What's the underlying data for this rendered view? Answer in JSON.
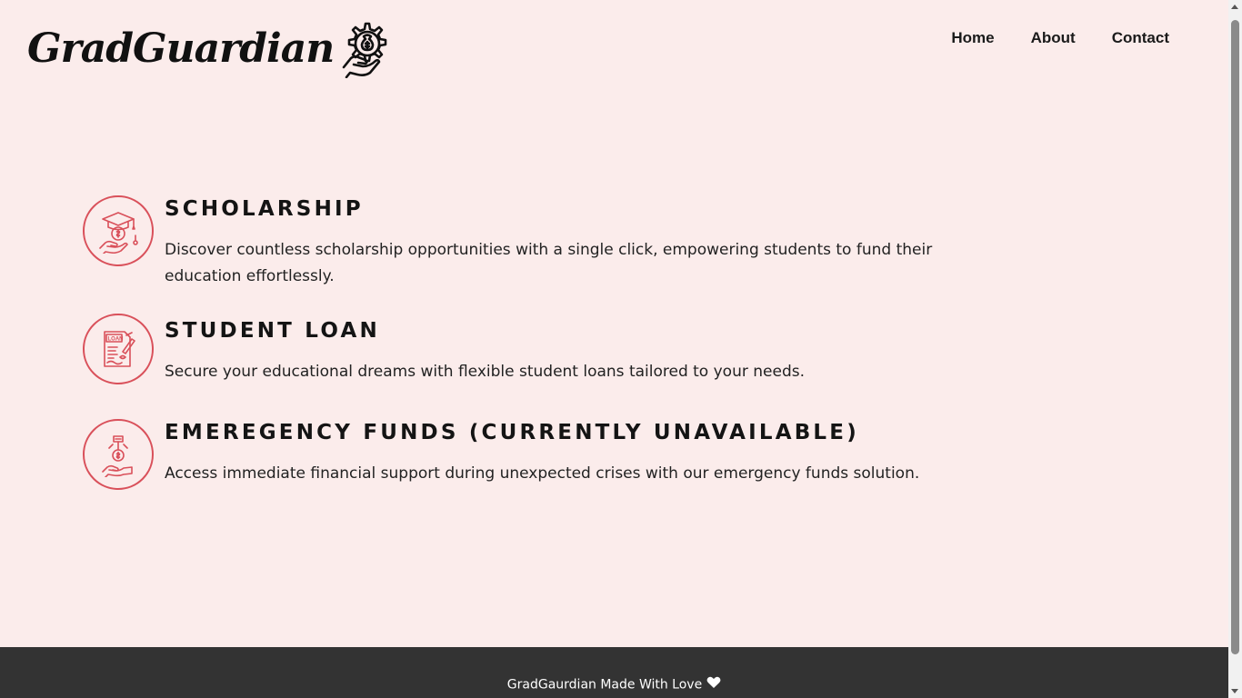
{
  "header": {
    "logo_text": "GradGuardian",
    "logo_icon": "money-bag-gear-hand-icon",
    "nav": [
      {
        "label": "Home"
      },
      {
        "label": "About"
      },
      {
        "label": "Contact"
      }
    ]
  },
  "services": [
    {
      "title": "SCHOLARSHIP",
      "description": "Discover countless scholarship opportunities with a single click, empowering students to fund their education effortlessly.",
      "icon": "scholarship-cap-hand-icon"
    },
    {
      "title": "STUDENT LOAN",
      "description": "Secure your educational dreams with flexible student loans tailored to your needs.",
      "icon": "loan-document-icon"
    },
    {
      "title": "EMEREGENCY FUNDS (CURRENTLY UNAVAILABLE)",
      "description": "Access immediate financial support during unexpected crises with our emergency funds solution.",
      "icon": "emergency-funds-hand-icon"
    }
  ],
  "footer": {
    "text": "GradGaurdian Made With Love",
    "icon": "heart-icon"
  },
  "colors": {
    "background": "#fbeceb",
    "accent": "#d9505a",
    "footer_bg": "#333333"
  }
}
